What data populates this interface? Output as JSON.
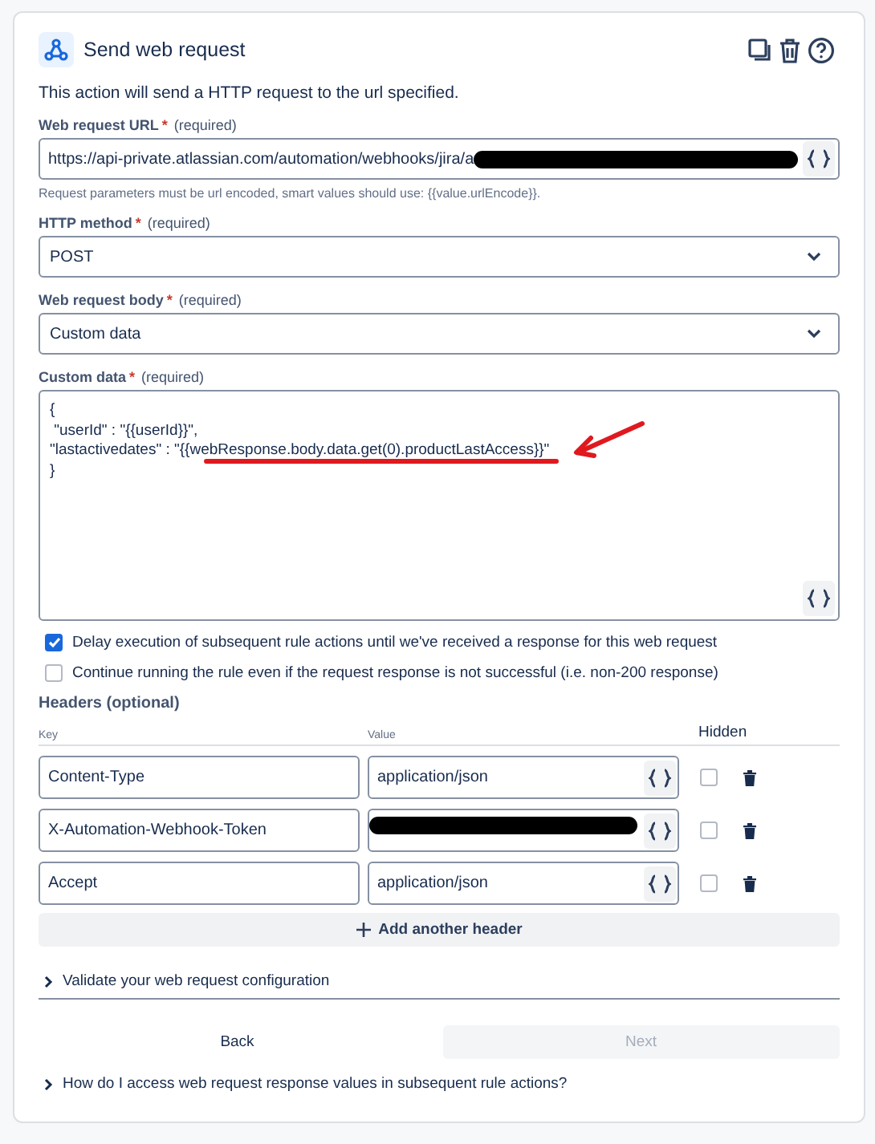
{
  "header": {
    "title": "Send web request",
    "description": "This action will send a HTTP request to the url specified."
  },
  "url_field": {
    "label": "Web request URL",
    "required_mark": "*",
    "required_text": "(required)",
    "value": "https://api-private.atlassian.com/automation/webhooks/jira/a",
    "redacted": true,
    "hint": "Request parameters must be url encoded, smart values should use: {{value.urlEncode}}."
  },
  "method_field": {
    "label": "HTTP method",
    "required_mark": "*",
    "required_text": "(required)",
    "value": "POST"
  },
  "body_field": {
    "label": "Web request body",
    "required_mark": "*",
    "required_text": "(required)",
    "value": "Custom data"
  },
  "custom_data": {
    "label": "Custom data",
    "required_mark": "*",
    "required_text": "(required)",
    "lines": [
      {
        "kind": "plain",
        "text": "{"
      },
      {
        "kind": "plain",
        "text": " \"userId\" : \"{{userId}}\","
      },
      {
        "kind": "annotated",
        "text": "\"lastactivedates\" : ",
        "underlined": "\"{{webResponse.body.data.get(0).productLastAccess}}\""
      },
      {
        "kind": "plain",
        "text": "}"
      }
    ]
  },
  "options": [
    {
      "label": "Delay execution of subsequent rule actions until we've received a response for this web request",
      "checked": true
    },
    {
      "label": "Continue running the rule even if the request response is not successful (i.e. non-200 response)",
      "checked": false
    }
  ],
  "headers": {
    "title": "Headers (optional)",
    "key_column": "Key",
    "value_column": "Value",
    "hidden_column": "Hidden",
    "rows": [
      {
        "key": "Content-Type",
        "value": "application/json",
        "redacted": false,
        "hidden": false
      },
      {
        "key": "X-Automation-Webhook-Token",
        "value": "",
        "redacted": true,
        "hidden": false
      },
      {
        "key": "Accept",
        "value": "application/json",
        "redacted": false,
        "hidden": false
      }
    ],
    "add_button": "Add another header"
  },
  "validate": {
    "label": "Validate your web request configuration",
    "expanded": false
  },
  "buttons": [
    {
      "label": "Back",
      "disabled": false
    },
    {
      "label": "Next",
      "disabled": true
    }
  ],
  "help": {
    "label": "How do I access web request response values in subsequent rule actions?",
    "expanded": false
  }
}
